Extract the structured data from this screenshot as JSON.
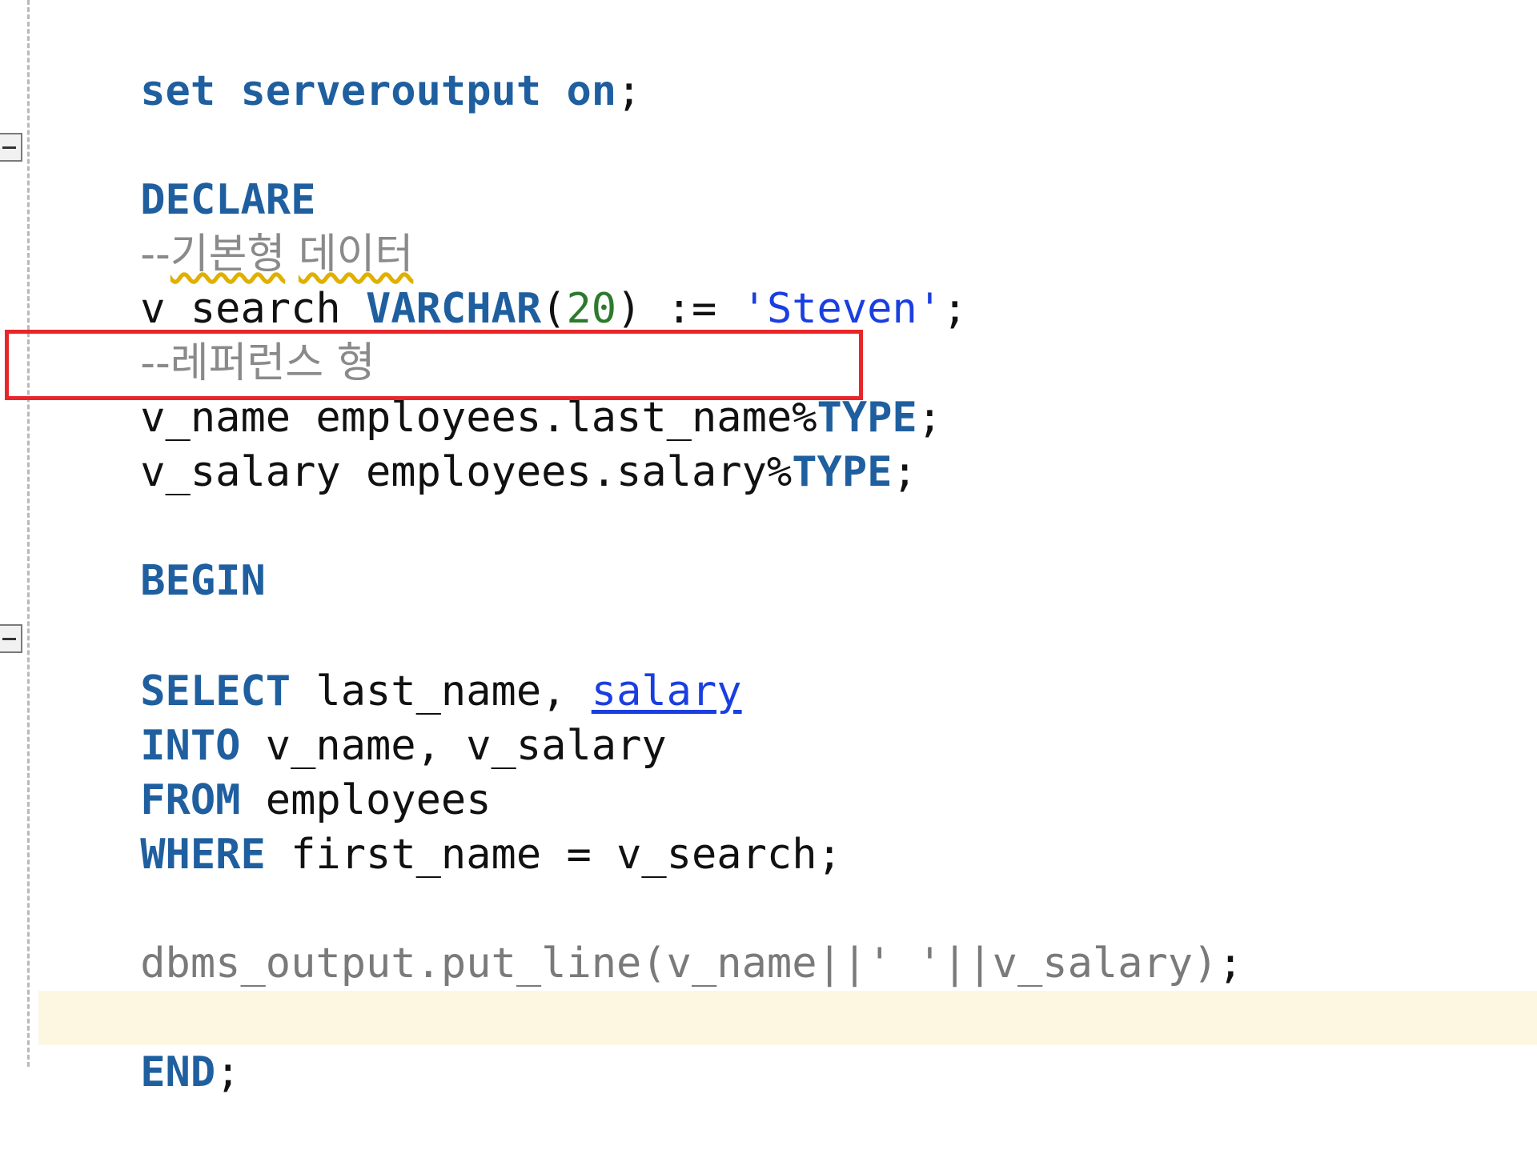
{
  "editor": {
    "lines": {
      "l1": {
        "kw1": "set",
        "sp1": " ",
        "kw2": "serveroutput",
        "sp2": " ",
        "kw3": "on",
        "rest": ";"
      },
      "l2": {
        "kw": "DECLARE"
      },
      "l3": {
        "comment_dash": "--",
        "comment_word1": "기본형",
        "comment_sp": " ",
        "comment_word2": "데이터"
      },
      "l4": {
        "a": "v_search ",
        "kw": "VARCHAR",
        "b": "(",
        "num": "20",
        "c": ") := ",
        "str": "'Steven'",
        "d": ";"
      },
      "l5": {
        "comment": "--레퍼런스 형"
      },
      "l6": {
        "a": "v_name employees.last_name%",
        "kw": "TYPE",
        "b": ";"
      },
      "l7": {
        "a": "v_salary employees.salary%",
        "kw": "TYPE",
        "b": ";"
      },
      "l8": {
        "kw": "BEGIN"
      },
      "l9": {
        "kw": "SELECT",
        "a": " last_name, ",
        "link": "salary"
      },
      "l10": {
        "kw": "INTO",
        "a": " v_name, v_salary"
      },
      "l11": {
        "kw": "FROM",
        "a": " employees"
      },
      "l12": {
        "kw": "WHERE",
        "a": " first_name = v_search;"
      },
      "l13": {
        "a": "dbms_output.put_line(v_name||' '||v_salary)",
        "b": ";"
      },
      "l14": {
        "kw": "END",
        "a": ";"
      }
    },
    "colors": {
      "keyword": "#1f5f9f",
      "number": "#2d7a2d",
      "string": "#1a3fe0",
      "comment": "#8a8a8a",
      "highlight_box": "#e8262a",
      "current_line": "#fdf7e2"
    }
  }
}
